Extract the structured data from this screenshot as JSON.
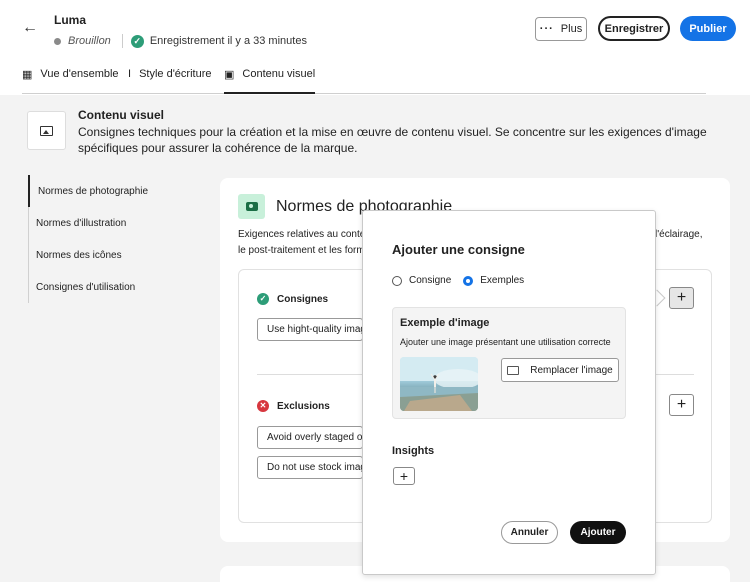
{
  "header": {
    "title": "Luma",
    "draft_label": "Brouillon",
    "save_status": "Enregistrement il y a 33 minutes",
    "more_label": "Plus",
    "save_label": "Enregistrer",
    "publish_label": "Publier",
    "publish_color": "#1473e6"
  },
  "tabs": [
    {
      "label": "Vue d'ensemble",
      "icon": "grid-icon"
    },
    {
      "label": "Style d'écriture",
      "icon": "text-cursor-icon"
    },
    {
      "label": "Contenu visuel",
      "icon": "image-icon",
      "active": true
    }
  ],
  "section": {
    "title": "Contenu visuel",
    "description": "Consignes techniques pour la création et la mise en œuvre de contenu visuel. Se concentre sur les exigences d'image spécifiques pour assurer  la cohérence de la marque."
  },
  "left_nav": [
    {
      "label": "Normes de photographie",
      "active": true
    },
    {
      "label": "Normes d'illustration"
    },
    {
      "label": "Normes des icônes"
    },
    {
      "label": "Consignes d'utilisation"
    }
  ],
  "card": {
    "title": "Normes de photographie",
    "description_left_1": "Exigences relatives au contenu",
    "description_right_1": "l'éclairage,",
    "description_left_2": "le post-traitement et les forma",
    "guidelines_label": "Consignes",
    "guideline_value": "Use hight-quality image",
    "exclusions_label": "Exclusions",
    "exclusion_value_1": "Avoid overly staged or c",
    "exclusion_value_2": "Do not use stock image",
    "success_color": "#2d9d78",
    "error_color": "#d7373f"
  },
  "popover": {
    "title": "Ajouter une consigne",
    "radio_options": [
      "Consigne",
      "Exemples"
    ],
    "selected_option": "Exemples",
    "example_title": "Exemple d'image",
    "example_desc": "Ajouter une image présentant une utilisation correcte",
    "replace_label": "Remplacer l'image",
    "insights_label": "Insights",
    "cancel_label": "Annuler",
    "add_label": "Ajouter"
  }
}
